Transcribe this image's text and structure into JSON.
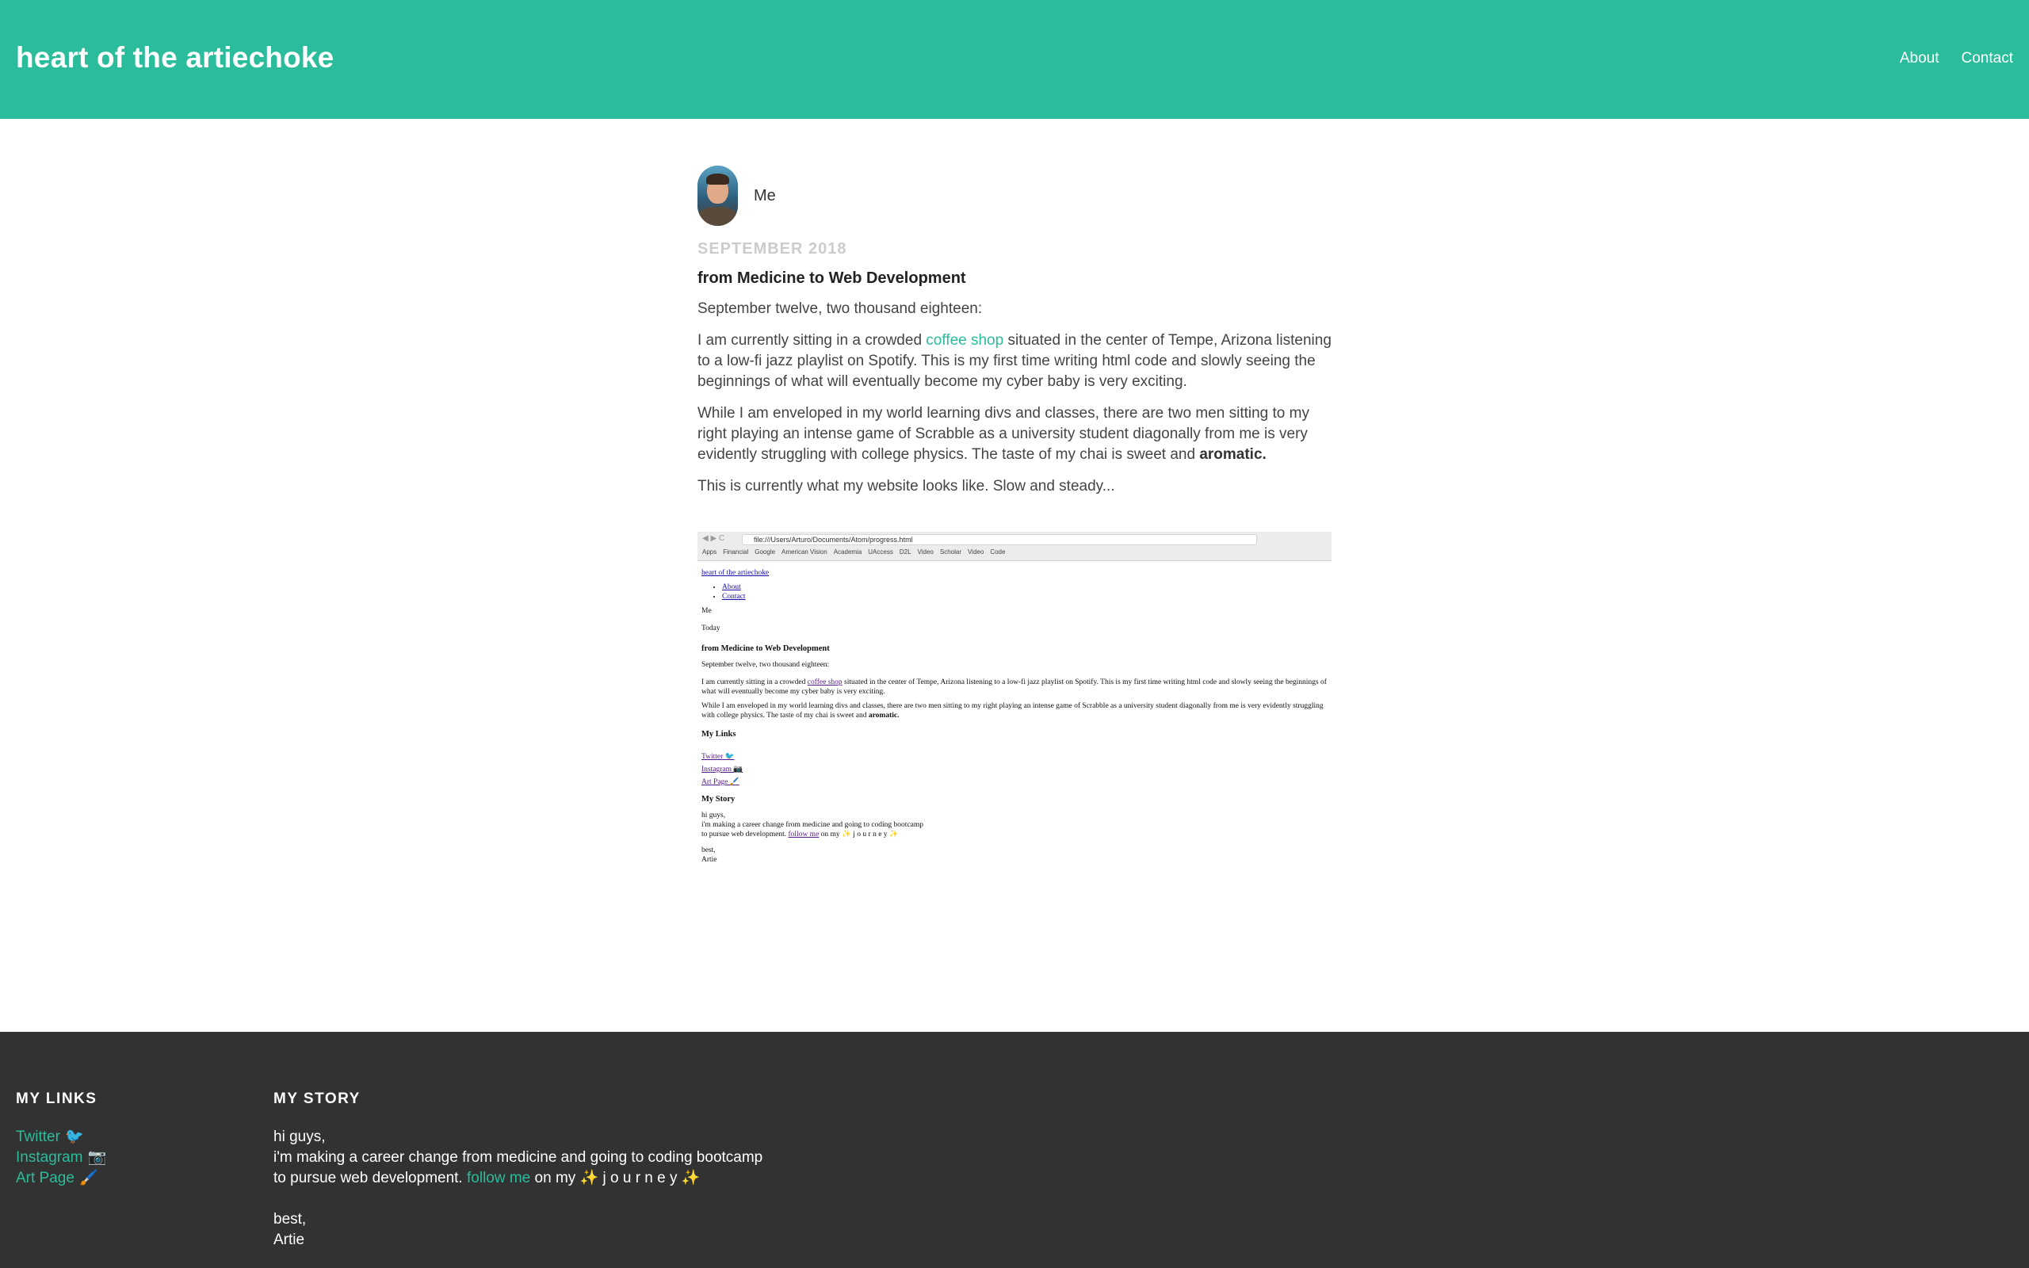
{
  "header": {
    "site_title": "heart of the artiechoke",
    "nav": [
      "About",
      "Contact"
    ],
    "bg_color": "#2bbc9c"
  },
  "post": {
    "author": "Me",
    "date": "SEPTEMBER 2018",
    "title": "from Medicine to Web Development",
    "p1": "September twelve, two thousand eighteen:",
    "p2_before": "I am currently sitting in a crowded ",
    "p2_link": "coffee shop",
    "p2_after": " situated in the center of Tempe, Arizona listening to a low-fi jazz playlist on Spotify. This is my first time writing html code and slowly seeing the beginnings of what will eventually become my cyber baby is very exciting.",
    "p3_before": "While I am enveloped in my world learning divs and classes, there are two men sitting to my right playing an intense game of Scrabble as a university student diagonally from me is very evidently struggling with college physics. The taste of my chai is sweet and ",
    "p3_bold": "aromatic.",
    "p4": "This is currently what my website looks like. Slow and steady..."
  },
  "screenshot": {
    "nav_buttons": "◀ ▶ C",
    "url": "file:///Users/Arturo/Documents/Atom/progress.html",
    "bookmarks": [
      "Apps",
      "Financial",
      "Google",
      "American Vision",
      "Academia",
      "UAccess",
      "D2L",
      "Video",
      "Scholar",
      "Video",
      "Code"
    ],
    "site_title": "heart of the artiechoke",
    "nav": [
      "About",
      "Contact"
    ],
    "author": "Me",
    "date": "Today",
    "title": "from Medicine to Web Development",
    "p1": "September twelve, two thousand eighteen:",
    "p2_before": "I am currently sitting in a crowded ",
    "p2_link": "coffee shop",
    "p2_after": " situated in the center of Tempe, Arizona listening to a low-fi jazz playlist on Spotify. This is my first time writing html code and slowly seeing the beginnings of what will eventually become my cyber baby is very exciting.",
    "p3_before": "While I am enveloped in my world learning divs and classes, there are two men sitting to my right playing an intense game of Scrabble as a university student diagonally from me is very evidently struggling with college physics. The taste of my chai is sweet and ",
    "p3_bold": "aromatic.",
    "links_heading": "My Links",
    "links": [
      "Twitter 🐦",
      "Instagram 📷",
      "Art Page 🖌️"
    ],
    "story_heading": "My Story",
    "story_l1": "hi guys,",
    "story_l2": "i'm making a career change from medicine and going to coding bootcamp",
    "story_l3_before": "to pursue web development. ",
    "story_l3_link": "follow me",
    "story_l3_after": " on my ✨ j o u r n e y ✨",
    "sign1": "best,",
    "sign2": "Artie"
  },
  "footer": {
    "links_heading": "MY LINKS",
    "links": [
      {
        "label": "Twitter",
        "emoji": "🐦"
      },
      {
        "label": "Instagram",
        "emoji": "📷"
      },
      {
        "label": "Art Page",
        "emoji": "🖌️"
      }
    ],
    "story_heading": "MY STORY",
    "story_l1": "hi guys,",
    "story_l2": "i'm making a career change from medicine and going to coding bootcamp",
    "story_l3_before": "to pursue web development. ",
    "story_l3_link": "follow me",
    "story_l3_mid": " on my ",
    "story_l3_spark1": "✨",
    "story_l3_word": " j o u r n e y ",
    "story_l3_spark2": "✨",
    "sign1": "best,",
    "sign2": "Artie",
    "bg_color": "#323232"
  }
}
